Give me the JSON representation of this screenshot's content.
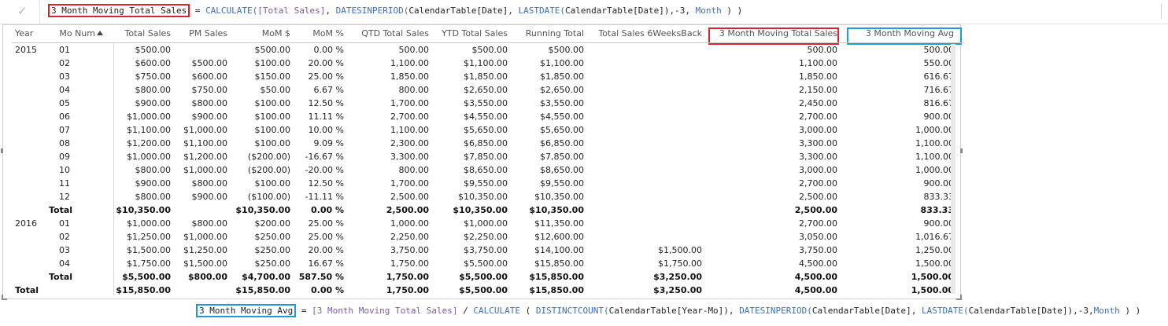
{
  "formula_bar": {
    "check_glyph": "✓",
    "measure_name": "3 Month Moving Total Sales",
    "parts": [
      {
        "t": " = ",
        "k": "op"
      },
      {
        "t": "CALCULATE(",
        "k": "fn"
      },
      {
        "t": "[Total Sales]",
        "k": "ref"
      },
      {
        "t": ", ",
        "k": "op"
      },
      {
        "t": "DATESINPERIOD(",
        "k": "fn"
      },
      {
        "t": "CalendarTable[Date]",
        "k": "op"
      },
      {
        "t": ", ",
        "k": "op"
      },
      {
        "t": "LASTDATE(",
        "k": "fn"
      },
      {
        "t": "CalendarTable[Date]",
        "k": "op"
      },
      {
        "t": "),-3, ",
        "k": "op"
      },
      {
        "t": "Month",
        "k": "fn"
      },
      {
        "t": " ) )",
        "k": "op"
      }
    ]
  },
  "table": {
    "headers": [
      "Year",
      "Mo Num",
      "Total Sales",
      "PM Sales",
      "MoM $",
      "MoM %",
      "QTD Total Sales",
      "YTD Total Sales",
      "Running Total",
      "Total Sales 6WeeksBack",
      "3 Month Moving Total Sales",
      "3 Month Moving Avg"
    ],
    "rows": [
      {
        "bold": false,
        "cells": [
          "2015",
          "01",
          "$500.00",
          "",
          "$500.00",
          "0.00 %",
          "500.00",
          "$500.00",
          "$500.00",
          "",
          "500.00",
          "500.00"
        ]
      },
      {
        "bold": false,
        "cells": [
          "",
          "02",
          "$600.00",
          "$500.00",
          "$100.00",
          "20.00 %",
          "1,100.00",
          "$1,100.00",
          "$1,100.00",
          "",
          "1,100.00",
          "550.00"
        ]
      },
      {
        "bold": false,
        "cells": [
          "",
          "03",
          "$750.00",
          "$600.00",
          "$150.00",
          "25.00 %",
          "1,850.00",
          "$1,850.00",
          "$1,850.00",
          "",
          "1,850.00",
          "616.67"
        ]
      },
      {
        "bold": false,
        "cells": [
          "",
          "04",
          "$800.00",
          "$750.00",
          "$50.00",
          "6.67 %",
          "800.00",
          "$2,650.00",
          "$2,650.00",
          "",
          "2,150.00",
          "716.67"
        ]
      },
      {
        "bold": false,
        "cells": [
          "",
          "05",
          "$900.00",
          "$800.00",
          "$100.00",
          "12.50 %",
          "1,700.00",
          "$3,550.00",
          "$3,550.00",
          "",
          "2,450.00",
          "816.67"
        ]
      },
      {
        "bold": false,
        "cells": [
          "",
          "06",
          "$1,000.00",
          "$900.00",
          "$100.00",
          "11.11 %",
          "2,700.00",
          "$4,550.00",
          "$4,550.00",
          "",
          "2,700.00",
          "900.00"
        ]
      },
      {
        "bold": false,
        "cells": [
          "",
          "07",
          "$1,100.00",
          "$1,000.00",
          "$100.00",
          "10.00 %",
          "1,100.00",
          "$5,650.00",
          "$5,650.00",
          "",
          "3,000.00",
          "1,000.00"
        ]
      },
      {
        "bold": false,
        "cells": [
          "",
          "08",
          "$1,200.00",
          "$1,100.00",
          "$100.00",
          "9.09 %",
          "2,300.00",
          "$6,850.00",
          "$6,850.00",
          "",
          "3,300.00",
          "1,100.00"
        ]
      },
      {
        "bold": false,
        "cells": [
          "",
          "09",
          "$1,000.00",
          "$1,200.00",
          "($200.00)",
          "-16.67 %",
          "3,300.00",
          "$7,850.00",
          "$7,850.00",
          "",
          "3,300.00",
          "1,100.00"
        ]
      },
      {
        "bold": false,
        "cells": [
          "",
          "10",
          "$800.00",
          "$1,000.00",
          "($200.00)",
          "-20.00 %",
          "800.00",
          "$8,650.00",
          "$8,650.00",
          "",
          "3,000.00",
          "1,000.00"
        ]
      },
      {
        "bold": false,
        "cells": [
          "",
          "11",
          "$900.00",
          "$800.00",
          "$100.00",
          "12.50 %",
          "1,700.00",
          "$9,550.00",
          "$9,550.00",
          "",
          "2,700.00",
          "900.00"
        ]
      },
      {
        "bold": false,
        "cells": [
          "",
          "12",
          "$800.00",
          "$900.00",
          "($100.00)",
          "-11.11 %",
          "2,500.00",
          "$10,350.00",
          "$10,350.00",
          "",
          "2,500.00",
          "833.33"
        ]
      },
      {
        "bold": true,
        "cells": [
          "",
          "Total",
          "$10,350.00",
          "",
          "$10,350.00",
          "0.00 %",
          "2,500.00",
          "$10,350.00",
          "$10,350.00",
          "",
          "2,500.00",
          "833.33"
        ]
      },
      {
        "bold": false,
        "cells": [
          "2016",
          "01",
          "$1,000.00",
          "$800.00",
          "$200.00",
          "25.00 %",
          "1,000.00",
          "$1,000.00",
          "$11,350.00",
          "",
          "2,700.00",
          "900.00"
        ]
      },
      {
        "bold": false,
        "cells": [
          "",
          "02",
          "$1,250.00",
          "$1,000.00",
          "$250.00",
          "25.00 %",
          "2,250.00",
          "$2,250.00",
          "$12,600.00",
          "",
          "3,050.00",
          "1,016.67"
        ]
      },
      {
        "bold": false,
        "cells": [
          "",
          "03",
          "$1,500.00",
          "$1,250.00",
          "$250.00",
          "20.00 %",
          "3,750.00",
          "$3,750.00",
          "$14,100.00",
          "$1,500.00",
          "3,750.00",
          "1,250.00"
        ]
      },
      {
        "bold": false,
        "cells": [
          "",
          "04",
          "$1,750.00",
          "$1,500.00",
          "$250.00",
          "16.67 %",
          "1,750.00",
          "$5,500.00",
          "$15,850.00",
          "$1,750.00",
          "4,500.00",
          "1,500.00"
        ]
      },
      {
        "bold": true,
        "cells": [
          "",
          "Total",
          "$5,500.00",
          "$800.00",
          "$4,700.00",
          "587.50 %",
          "1,750.00",
          "$5,500.00",
          "$15,850.00",
          "$3,250.00",
          "4,500.00",
          "1,500.00"
        ]
      },
      {
        "bold": true,
        "cells": [
          "Total",
          "",
          "$15,850.00",
          "",
          "$15,850.00",
          "0.00 %",
          "1,750.00",
          "$5,500.00",
          "$15,850.00",
          "$3,250.00",
          "4,500.00",
          "1,500.00"
        ]
      }
    ]
  },
  "bottom_formula": {
    "measure_name": "3 Month Moving Avg",
    "parts": [
      {
        "t": " = ",
        "k": "op"
      },
      {
        "t": "[3 Month Moving Total Sales]",
        "k": "ref"
      },
      {
        "t": " / ",
        "k": "op"
      },
      {
        "t": "CALCULATE",
        "k": "fn"
      },
      {
        "t": " ( ",
        "k": "op"
      },
      {
        "t": "DISTINCTCOUNT(",
        "k": "fn"
      },
      {
        "t": "CalendarTable[Year-Mo]",
        "k": "op"
      },
      {
        "t": "), ",
        "k": "op"
      },
      {
        "t": "DATESINPERIOD(",
        "k": "fn"
      },
      {
        "t": "CalendarTable[Date]",
        "k": "op"
      },
      {
        "t": ", ",
        "k": "op"
      },
      {
        "t": "LASTDATE(",
        "k": "fn"
      },
      {
        "t": "CalendarTable[Date]",
        "k": "op"
      },
      {
        "t": "),-3,",
        "k": "op"
      },
      {
        "t": "Month",
        "k": "fn"
      },
      {
        "t": " ) )",
        "k": "op"
      }
    ]
  },
  "colors": {
    "highlight_red": "#d9232d",
    "highlight_blue": "#1d9bd8",
    "function": "#3d6fb5",
    "reference": "#7d5aa8"
  },
  "icons": {
    "commit": "check-icon",
    "sort": "sort-ascending-icon"
  }
}
